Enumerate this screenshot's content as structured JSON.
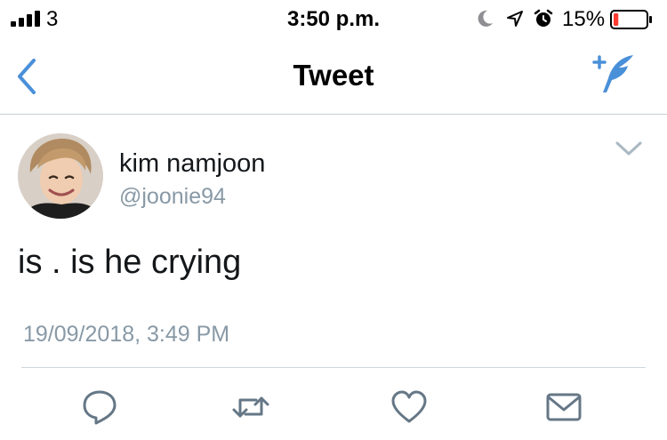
{
  "status_bar": {
    "carrier": "3",
    "time": "3:50 p.m.",
    "battery_percent": "15%",
    "battery_level": 0.15,
    "icons": [
      "signal-bars-icon",
      "moon-icon",
      "location-arrow-icon",
      "alarm-clock-icon",
      "battery-icon"
    ]
  },
  "nav": {
    "title": "Tweet",
    "back_icon": "chevron-left-icon",
    "compose_icon": "compose-tweet-icon"
  },
  "tweet": {
    "display_name": "kim namjoon",
    "handle": "@joonie94",
    "text": "is . is he crying",
    "timestamp": "19/09/2018, 3:49 PM",
    "menu_icon": "chevron-down-icon"
  },
  "actions": [
    {
      "name": "reply",
      "icon": "reply-bubble-icon"
    },
    {
      "name": "retweet",
      "icon": "retweet-icon"
    },
    {
      "name": "like",
      "icon": "heart-icon"
    },
    {
      "name": "direct-message",
      "icon": "envelope-icon"
    }
  ],
  "colors": {
    "accent": "#4a90d9",
    "secondary_text": "#8899a6",
    "icon_gray": "#657786",
    "battery_low": "#ff3b30"
  }
}
